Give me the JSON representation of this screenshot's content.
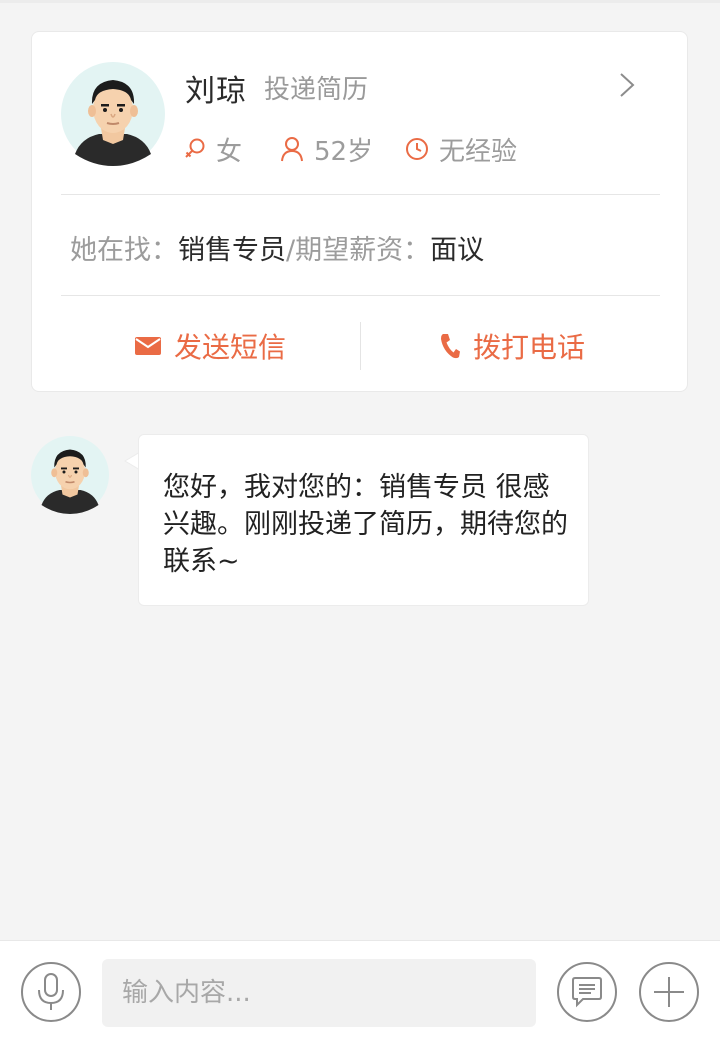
{
  "profile": {
    "name": "刘琼",
    "action_tag": "投递简历",
    "gender": "女",
    "age": "52岁",
    "experience": "无经验",
    "seeking_label": "她在找：",
    "job_title": "销售专员",
    "salary_label": "/期望薪资：",
    "salary_value": "面议"
  },
  "actions": {
    "sms_label": "发送短信",
    "call_label": "拨打电话"
  },
  "chat": {
    "messages": [
      {
        "text": "您好，我对您的：销售专员 很感兴趣。刚刚投递了简历，期待您的联系~"
      }
    ]
  },
  "composer": {
    "placeholder": "输入内容..."
  },
  "colors": {
    "accent": "#ea6b45",
    "muted": "#9c9c9c",
    "background": "#f4f4f4"
  },
  "icons": [
    "avatar",
    "chevron-right-icon",
    "female-icon",
    "person-icon",
    "clock-icon",
    "envelope-icon",
    "phone-icon",
    "microphone-icon",
    "chat-bubble-icon",
    "plus-icon"
  ]
}
